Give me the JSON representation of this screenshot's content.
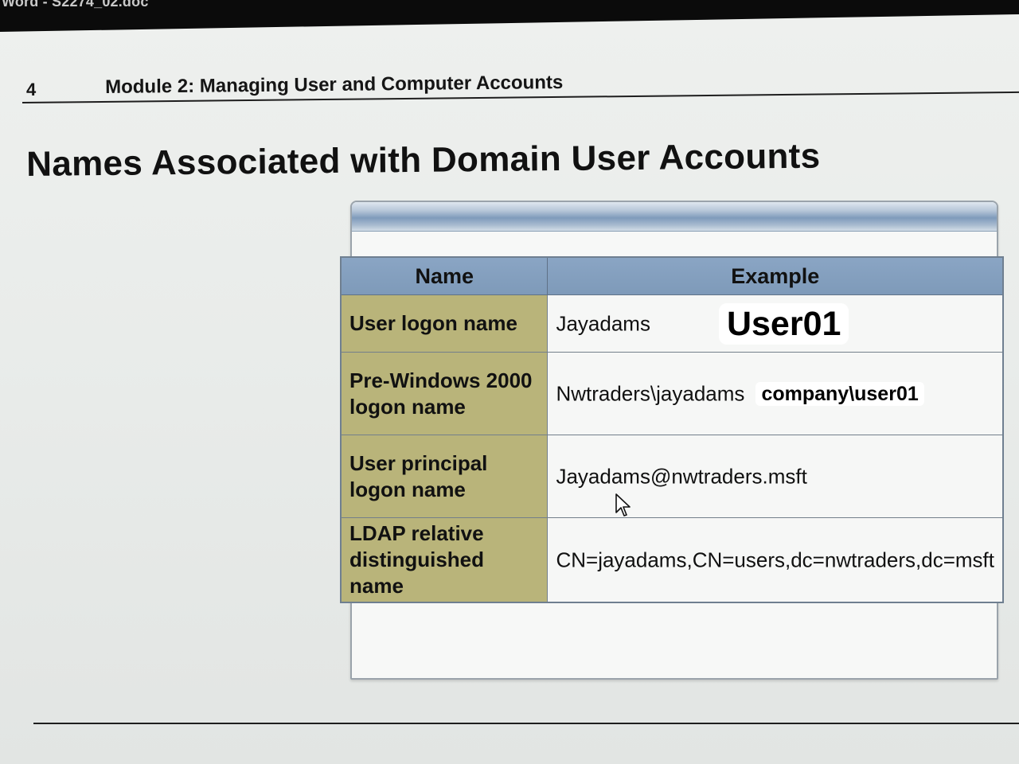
{
  "window": {
    "title": "Word - S2274_02.doc"
  },
  "header": {
    "page_number": "4",
    "module_title": "Module 2: Managing User and Computer Accounts"
  },
  "slide": {
    "title": "Names Associated with Domain User Accounts",
    "table": {
      "headers": [
        "Name",
        "Example"
      ],
      "rows": [
        {
          "name": "User logon name",
          "example": "Jayadams",
          "overlay": "User01"
        },
        {
          "name": "Pre-Windows 2000 logon name",
          "example": "Nwtraders\\jayadams",
          "overlay": "company\\user01"
        },
        {
          "name": "User principal logon name",
          "example": "Jayadams@nwtraders.msft"
        },
        {
          "name": "LDAP relative distinguished name",
          "example": "CN=jayadams,CN=users,dc=nwtraders,dc=msft"
        }
      ]
    }
  },
  "colors": {
    "header_fill": "#7e9ab9",
    "name_column_fill": "#b9b47a",
    "title_bar": "#0b0b0b"
  },
  "icons": {
    "cursor": "mouse-pointer-icon"
  }
}
